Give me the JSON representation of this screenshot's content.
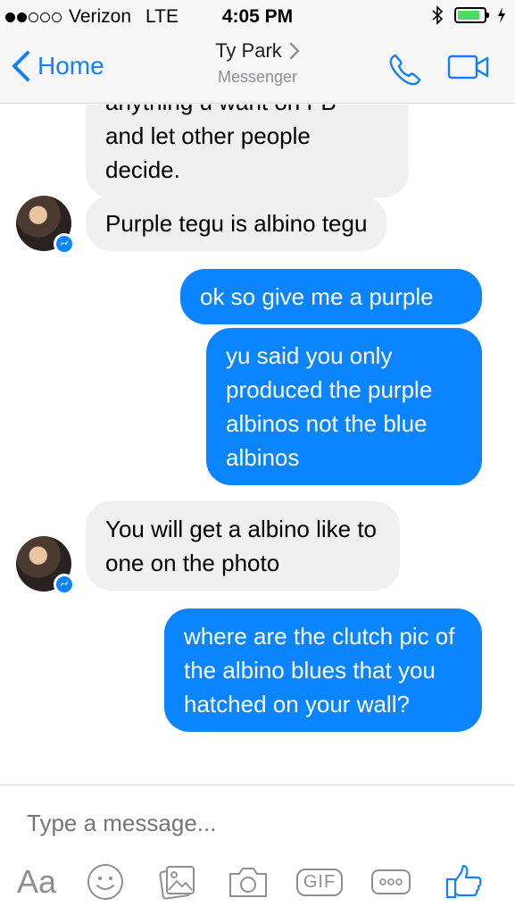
{
  "status_bar": {
    "carrier": "Verizon",
    "network": "LTE",
    "time": "4:05 PM",
    "bluetooth_icon": "bluetooth-icon",
    "battery_level": 0.85,
    "battery_color": "#4cd964"
  },
  "nav": {
    "back_label": "Home",
    "title": "Ty Park",
    "subtitle": "Messenger"
  },
  "messages": [
    {
      "side": "in",
      "text_lines": [
        "anything u want on FB",
        "and let other people",
        "decide."
      ]
    },
    {
      "side": "in",
      "text": "Purple tegu is albino tegu"
    },
    {
      "side": "out",
      "text": "ok so give me a purple"
    },
    {
      "side": "out",
      "text": "yu said you only produced the purple albinos not the blue albinos"
    },
    {
      "side": "in",
      "text": "You will get a albino like to one on the photo"
    },
    {
      "side": "out",
      "text": "where are the clutch pic of the albino blues that you hatched on your wall?"
    }
  ],
  "composer": {
    "placeholder": "Type a message...",
    "aa_label": "Aa",
    "gif_label": "GIF"
  },
  "colors": {
    "accent": "#147efb",
    "outgoing_bubble": "#0a84ff",
    "incoming_bubble": "#f0f0f0"
  }
}
